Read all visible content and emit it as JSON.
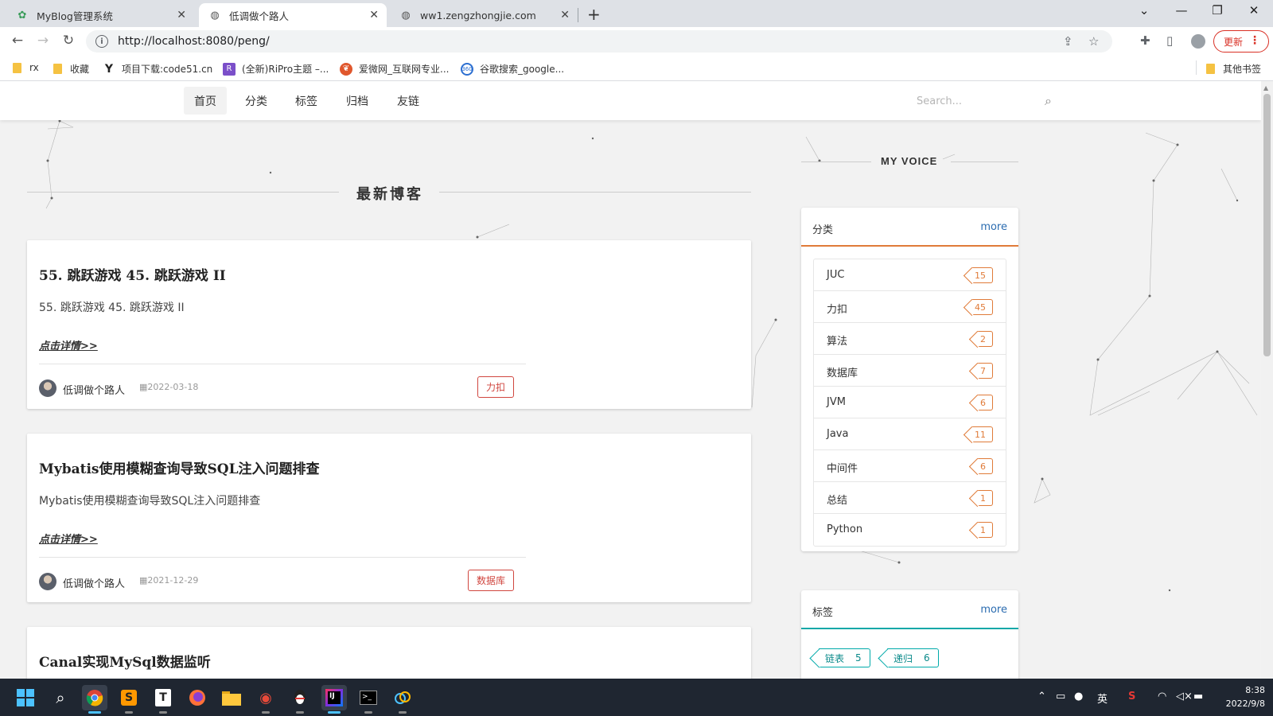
{
  "browser": {
    "tabs": [
      {
        "title": "MyBlog管理系统",
        "icon": "leaf-icon"
      },
      {
        "title": "低调做个路人",
        "icon": "globe-icon"
      },
      {
        "title": "ww1.zengzhongjie.com",
        "icon": "globe-icon"
      }
    ],
    "url": "http://localhost:8080/peng/",
    "update_label": "更新",
    "bookmarks": [
      "rx",
      "收藏",
      "项目下载:code51.cn",
      "(全新)RiPro主题 –...",
      "爱微网_互联网专业...",
      "谷歌搜索_google..."
    ],
    "other_bookmarks": "其他书签"
  },
  "site": {
    "nav": [
      "首页",
      "分类",
      "标签",
      "归档",
      "友链"
    ],
    "search_placeholder": "Search...",
    "section_title": "最新博客",
    "my_voice": "MY VOICE",
    "posts": [
      {
        "title": "55. 跳跃游戏 45. 跳跃游戏 II",
        "desc": "55. 跳跃游戏 45. 跳跃游戏 II",
        "more": "点击详情>>",
        "author": "低调做个路人",
        "date": "2022-03-18",
        "tag": "力扣"
      },
      {
        "title": "Mybatis使用模糊查询导致SQL注入问题排查",
        "desc": "Mybatis使用模糊查询导致SQL注入问题排查",
        "more": "点击详情>>",
        "author": "低调做个路人",
        "date": "2021-12-29",
        "tag": "数据库"
      },
      {
        "title": "Canal实现MySql数据监听"
      }
    ],
    "categories_widget": {
      "title": "分类",
      "more": "more",
      "accent": "#e07b39",
      "items": [
        {
          "name": "JUC",
          "count": "15"
        },
        {
          "name": "力扣",
          "count": "45"
        },
        {
          "name": "算法",
          "count": "2"
        },
        {
          "name": "数据库",
          "count": "7"
        },
        {
          "name": "JVM",
          "count": "6"
        },
        {
          "name": "Java",
          "count": "11"
        },
        {
          "name": "中间件",
          "count": "6"
        },
        {
          "name": "总结",
          "count": "1"
        },
        {
          "name": "Python",
          "count": "1"
        }
      ]
    },
    "tags_widget": {
      "title": "标签",
      "more": "more",
      "accent": "#11a8a8",
      "items": [
        {
          "name": "链表",
          "count": "5"
        },
        {
          "name": "递归",
          "count": "6"
        }
      ]
    }
  },
  "taskbar": {
    "apps": [
      "start-icon",
      "search-icon",
      "chrome-icon",
      "sublime-icon",
      "typora-icon",
      "firefox-icon",
      "folder-icon",
      "browser-snail-icon",
      "qq-icon",
      "intellij-icon",
      "terminal-icon",
      "vpn-icon"
    ],
    "ime": "英",
    "time": "8:38",
    "date": "2022/9/8"
  }
}
